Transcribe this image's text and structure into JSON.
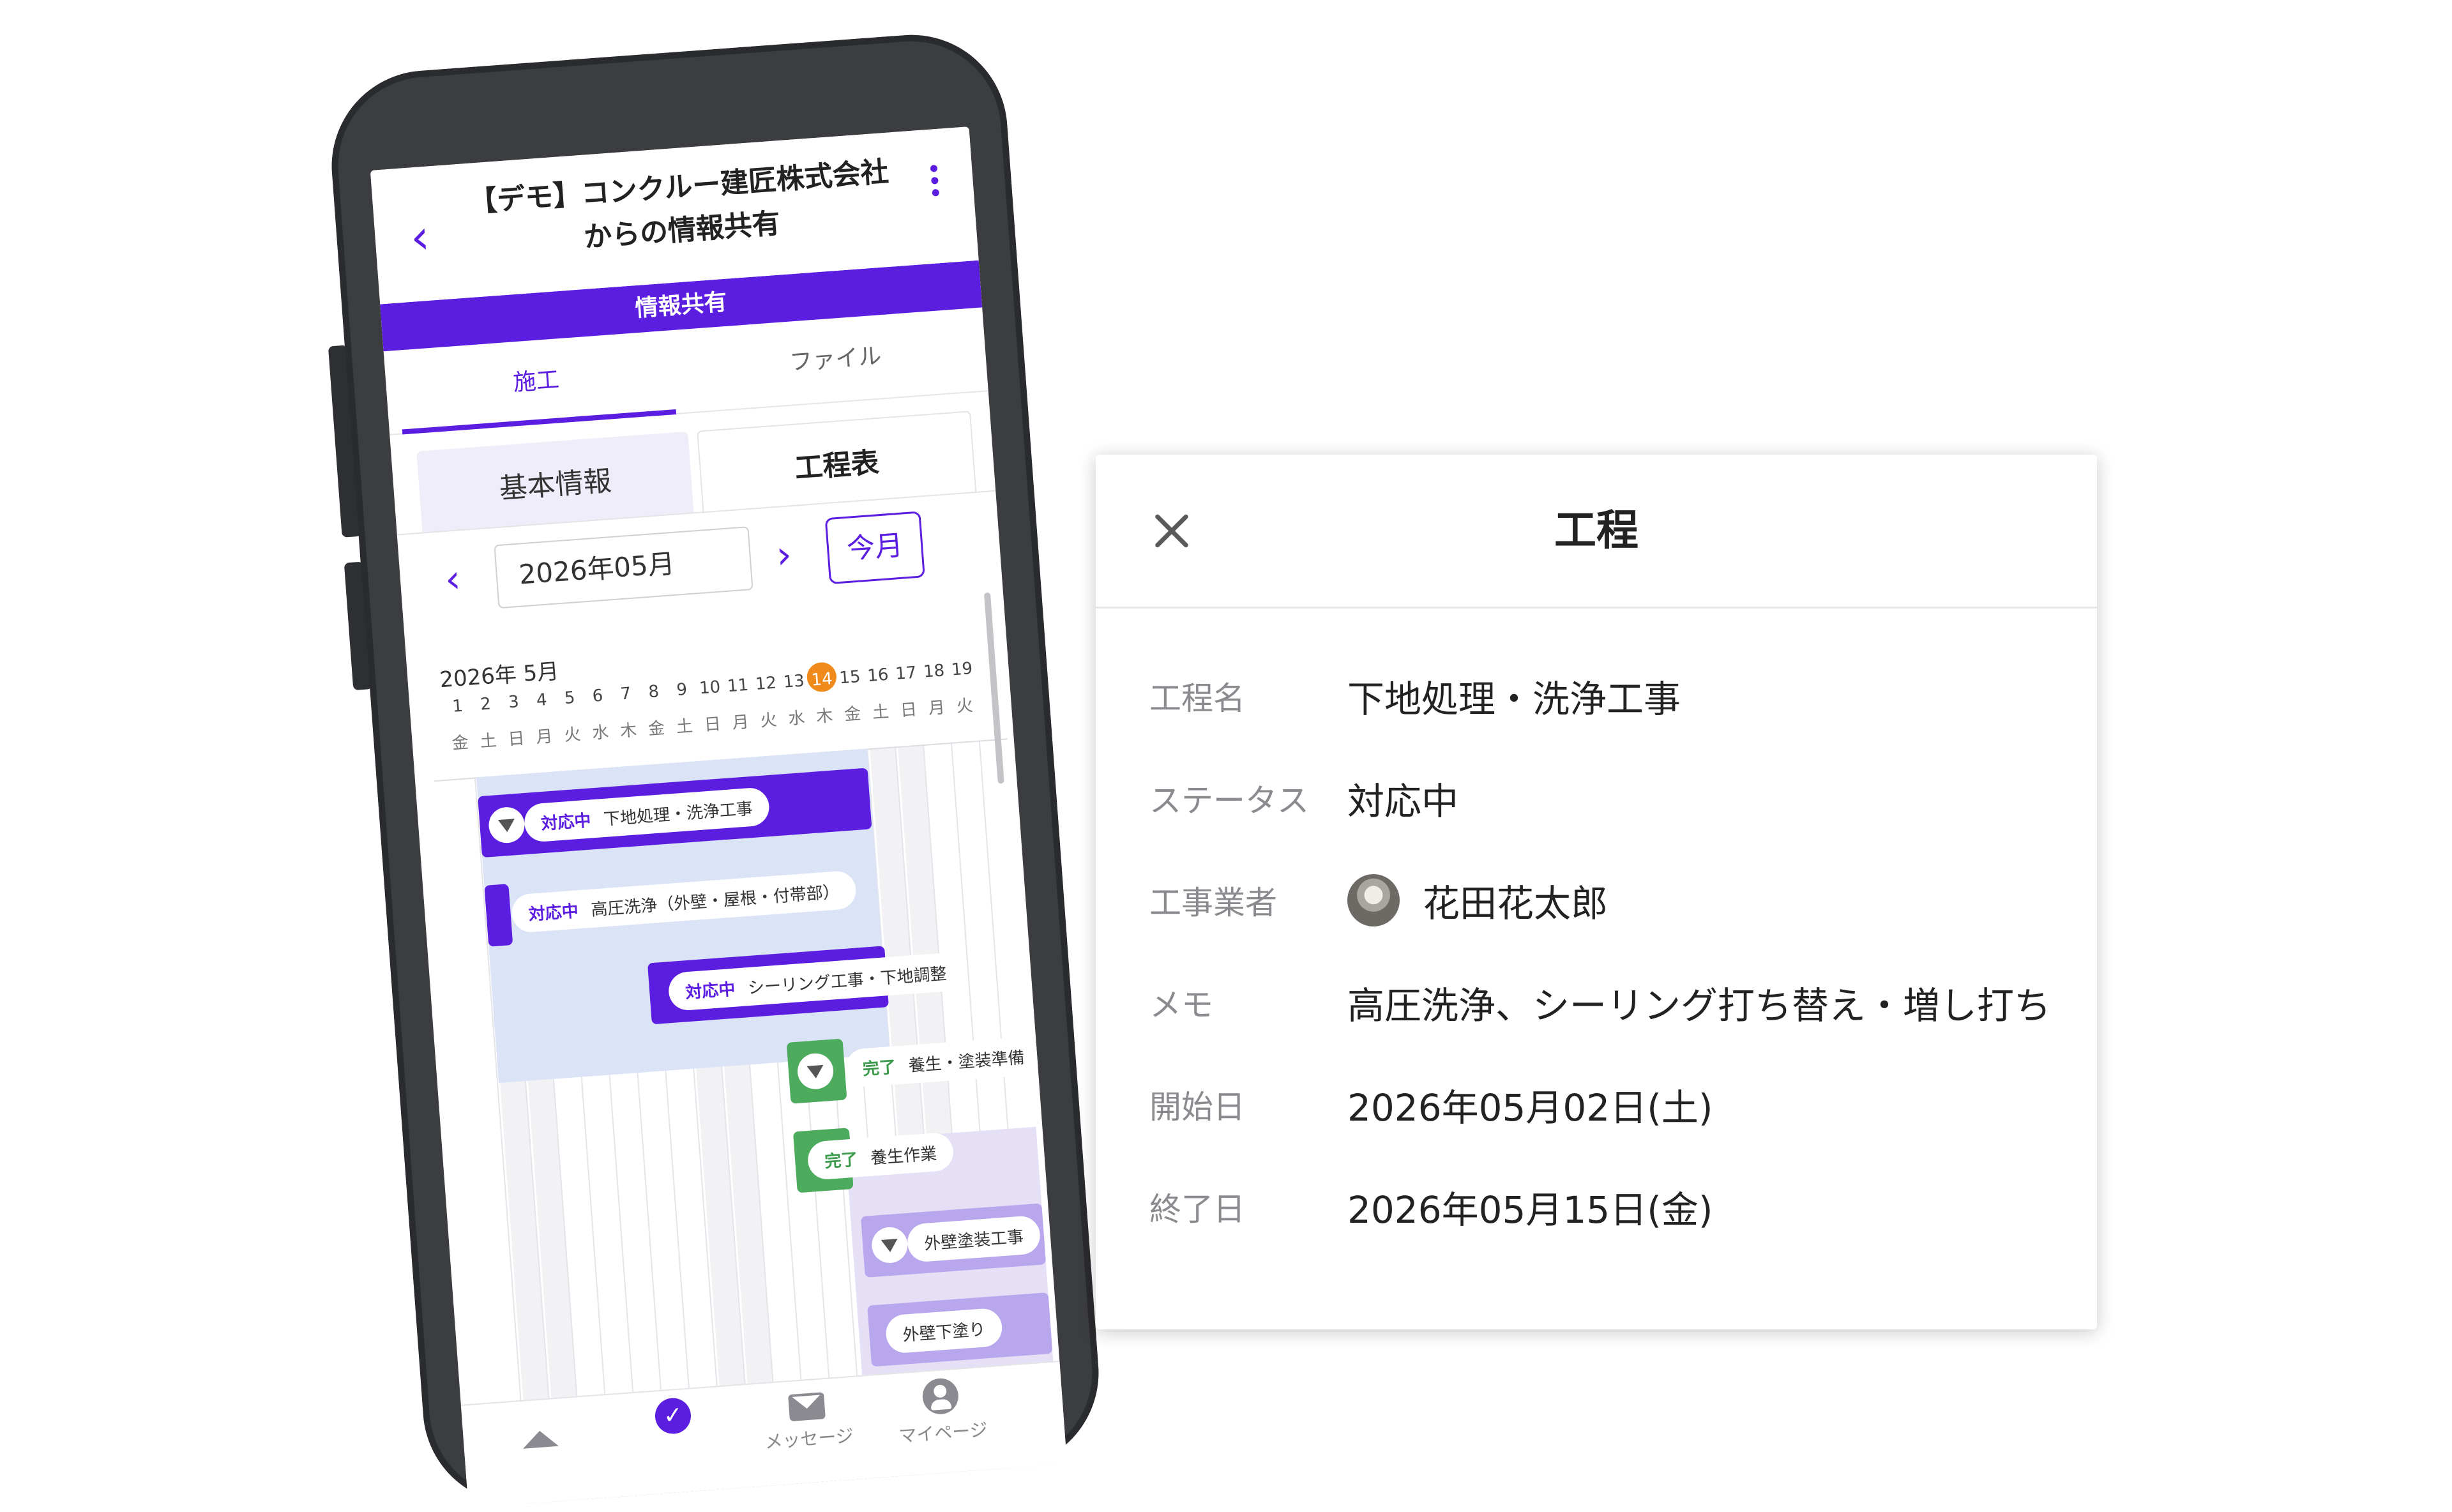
{
  "app": {
    "title": "【デモ】コンクルー建匠株式会社からの情報共有",
    "section_band": "情報共有"
  },
  "tabs": {
    "construction": "施工",
    "files": "ファイル"
  },
  "subtabs": {
    "basic": "基本情報",
    "schedule": "工程表"
  },
  "month_nav": {
    "field_value": "2026年05月",
    "today_label": "今月"
  },
  "gantt": {
    "month_label": "2026年 5月",
    "today": 14,
    "days": [
      "1",
      "2",
      "3",
      "4",
      "5",
      "6",
      "7",
      "8",
      "9",
      "10",
      "11",
      "12",
      "13",
      "14",
      "15",
      "16",
      "17",
      "18",
      "19"
    ],
    "weekdays": [
      "金",
      "土",
      "日",
      "月",
      "火",
      "水",
      "木",
      "金",
      "土",
      "日",
      "月",
      "火",
      "水",
      "木",
      "金",
      "土",
      "日",
      "月",
      "火"
    ],
    "tasks": [
      {
        "status": "対応中",
        "name": "下地処理・洗浄工事"
      },
      {
        "status": "対応中",
        "name": "高圧洗浄（外壁・屋根・付帯部）"
      },
      {
        "status": "対応中",
        "name": "シーリング工事・下地調整"
      },
      {
        "status": "完了",
        "name": "養生・塗装準備"
      },
      {
        "status": "完了",
        "name": "養生作業"
      },
      {
        "status": "",
        "name": "外壁塗装工事"
      },
      {
        "status": "",
        "name": "外壁下塗り"
      }
    ]
  },
  "bottom_nav": {
    "messages": "メッセージ",
    "mypage": "マイページ"
  },
  "colors": {
    "primary": "#5b1de0",
    "done": "#4dab5d",
    "today": "#f08a1a"
  },
  "detail": {
    "title": "工程",
    "rows": [
      {
        "label": "工程名",
        "value": "下地処理・洗浄工事"
      },
      {
        "label": "ステータス",
        "value": "対応中"
      },
      {
        "label": "工事業者",
        "value": "花田花太郎"
      },
      {
        "label": "メモ",
        "value": "高圧洗浄、シーリング打ち替え・増し打ち"
      },
      {
        "label": "開始日",
        "value": "2026年05月02日(土)"
      },
      {
        "label": "終了日",
        "value": "2026年05月15日(金)"
      }
    ]
  }
}
